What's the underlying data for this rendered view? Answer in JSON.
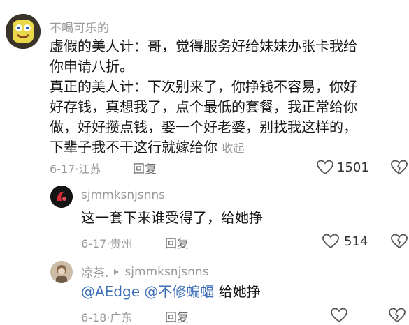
{
  "comments": [
    {
      "username": "不喝可乐的",
      "lines": [
        "虚假的美人计：哥，觉得服务好给妹妹办张卡我给",
        "你申请八折。",
        "真正的美人计：下次别来了，你挣钱不容易，你好",
        "好存钱，真想我了，点个最低的套餐，我正常给你",
        "做，好好攒点钱，娶一个好老婆，别找我这样的，",
        "下辈子我不干这行就嫁给你"
      ],
      "collapse_label": "收起",
      "date": "6-17",
      "location": "江苏",
      "reply_label": "回复",
      "likes": "1501"
    },
    {
      "username": "sjmmksnjsnns",
      "text": "这一套下来谁受得了，给她挣",
      "date": "6-17",
      "location": "贵州",
      "reply_label": "回复",
      "likes": "514"
    },
    {
      "username": "凉茶.",
      "reply_to": "sjmmksnjsnns",
      "mention1": "@AEdge",
      "mention2": "@不修蝙蝠",
      "text": "给她挣",
      "date": "6-18",
      "location": "广东",
      "reply_label": "回复"
    }
  ],
  "separator": "·",
  "icons": [
    "heart-icon",
    "dislike-heart-icon",
    "reply-arrow-icon"
  ],
  "colors": {
    "text": "#161616",
    "muted": "#9a9a9a",
    "mention": "#3d6fb6"
  }
}
